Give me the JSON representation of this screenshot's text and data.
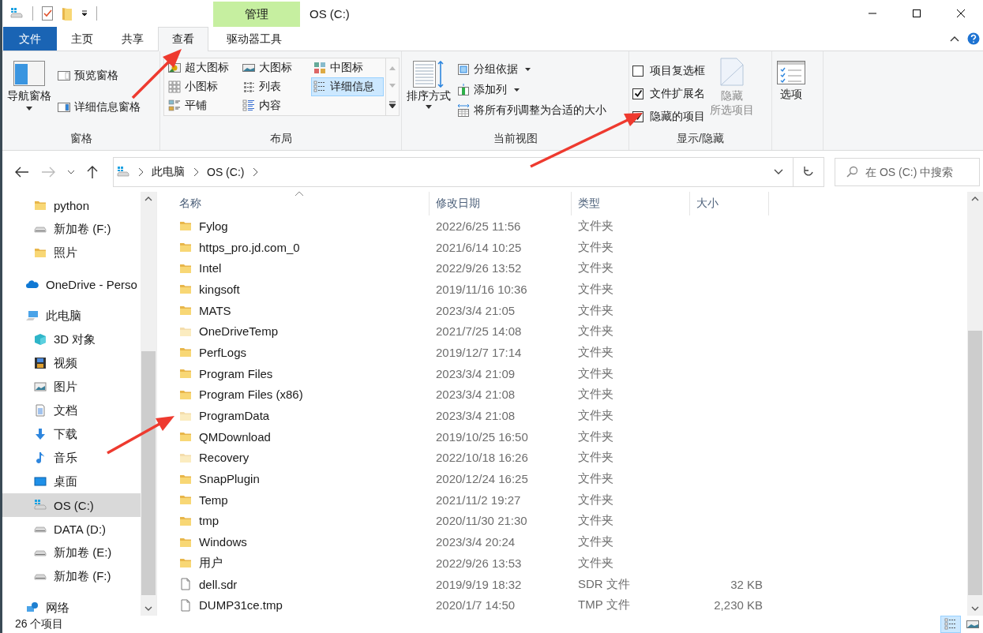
{
  "window": {
    "title": "OS (C:)",
    "context_tab_header": "管理"
  },
  "tabs": [
    {
      "label": "文件",
      "kind": "file",
      "selected": false
    },
    {
      "label": "主页",
      "kind": "normal",
      "selected": false
    },
    {
      "label": "共享",
      "kind": "normal",
      "selected": false
    },
    {
      "label": "查看",
      "kind": "normal",
      "selected": true
    },
    {
      "label": "驱动器工具",
      "kind": "context",
      "selected": false
    }
  ],
  "ribbon": {
    "panes": {
      "label": "窗格",
      "nav_button": "导航窗格",
      "items": [
        "预览窗格",
        "详细信息窗格"
      ]
    },
    "layout": {
      "label": "布局",
      "options": [
        {
          "label": "超大图标",
          "kind": "xl",
          "selected": false
        },
        {
          "label": "大图标",
          "kind": "large",
          "selected": false
        },
        {
          "label": "中图标",
          "kind": "medium",
          "selected": false
        },
        {
          "label": "小图标",
          "kind": "small",
          "selected": false
        },
        {
          "label": "列表",
          "kind": "list",
          "selected": false
        },
        {
          "label": "详细信息",
          "kind": "details",
          "selected": true
        },
        {
          "label": "平铺",
          "kind": "tiles",
          "selected": false
        },
        {
          "label": "内容",
          "kind": "content",
          "selected": false
        }
      ]
    },
    "current_view": {
      "label": "当前视图",
      "sort_button": "排序方式",
      "items": [
        {
          "label": "分组依据",
          "kind": "group",
          "dropdown": true
        },
        {
          "label": "添加列",
          "kind": "addcol",
          "dropdown": true
        },
        {
          "label": "将所有列调整为合适的大小",
          "kind": "fit",
          "dropdown": false
        }
      ]
    },
    "show_hide": {
      "label": "显示/隐藏",
      "checkboxes": [
        {
          "label": "项目复选框",
          "checked": false
        },
        {
          "label": "文件扩展名",
          "checked": true
        },
        {
          "label": "隐藏的项目",
          "checked": true
        }
      ],
      "hide_button": {
        "lines": [
          "隐藏",
          "所选项目"
        ],
        "disabled": true
      }
    },
    "options": {
      "label": "选项"
    }
  },
  "address": {
    "crumbs": [
      "此电脑",
      "OS (C:)"
    ],
    "search_placeholder": "在 OS (C:) 中搜索"
  },
  "nav": {
    "quick_access": [
      {
        "label": "python",
        "kind": "folder",
        "selected": false
      },
      {
        "label": "新加卷 (F:)",
        "kind": "drive",
        "selected": false
      },
      {
        "label": "照片",
        "kind": "folder",
        "selected": false
      }
    ],
    "items": [
      {
        "label": "OneDrive - Perso",
        "kind": "cloud",
        "selected": false
      },
      {
        "label": "此电脑",
        "kind": "computer",
        "selected": false,
        "children": [
          {
            "label": "3D 对象",
            "kind": "cube",
            "selected": false
          },
          {
            "label": "视频",
            "kind": "video",
            "selected": false
          },
          {
            "label": "图片",
            "kind": "image",
            "selected": false
          },
          {
            "label": "文档",
            "kind": "document",
            "selected": false
          },
          {
            "label": "下载",
            "kind": "download",
            "selected": false
          },
          {
            "label": "音乐",
            "kind": "music",
            "selected": false
          },
          {
            "label": "桌面",
            "kind": "desktop",
            "selected": false
          },
          {
            "label": "OS (C:)",
            "kind": "osdrive",
            "selected": true
          },
          {
            "label": "DATA (D:)",
            "kind": "drive",
            "selected": false
          },
          {
            "label": "新加卷 (E:)",
            "kind": "drive",
            "selected": false
          },
          {
            "label": "新加卷 (F:)",
            "kind": "drive",
            "selected": false
          }
        ]
      },
      {
        "label": "网络",
        "kind": "network",
        "selected": false
      }
    ]
  },
  "table": {
    "columns": [
      "名称",
      "修改日期",
      "类型",
      "大小"
    ],
    "rows": [
      {
        "name": "Fylog",
        "date": "2022/6/25 11:56",
        "type": "文件夹",
        "kind": "folder",
        "hidden": false
      },
      {
        "name": "https_pro.jd.com_0",
        "date": "2021/6/14 10:25",
        "type": "文件夹",
        "kind": "folder",
        "hidden": false
      },
      {
        "name": "Intel",
        "date": "2022/9/26 13:52",
        "type": "文件夹",
        "kind": "folder",
        "hidden": false
      },
      {
        "name": "kingsoft",
        "date": "2019/11/16 10:36",
        "type": "文件夹",
        "kind": "folder",
        "hidden": false
      },
      {
        "name": "MATS",
        "date": "2023/3/4 21:05",
        "type": "文件夹",
        "kind": "folder",
        "hidden": false
      },
      {
        "name": "OneDriveTemp",
        "date": "2021/7/25 14:08",
        "type": "文件夹",
        "kind": "folder",
        "hidden": true
      },
      {
        "name": "PerfLogs",
        "date": "2019/12/7 17:14",
        "type": "文件夹",
        "kind": "folder",
        "hidden": false
      },
      {
        "name": "Program Files",
        "date": "2023/3/4 21:09",
        "type": "文件夹",
        "kind": "folder",
        "hidden": false
      },
      {
        "name": "Program Files (x86)",
        "date": "2023/3/4 21:08",
        "type": "文件夹",
        "kind": "folder",
        "hidden": false
      },
      {
        "name": "ProgramData",
        "date": "2023/3/4 21:08",
        "type": "文件夹",
        "kind": "folder",
        "hidden": true
      },
      {
        "name": "QMDownload",
        "date": "2019/10/25 16:50",
        "type": "文件夹",
        "kind": "folder",
        "hidden": false
      },
      {
        "name": "Recovery",
        "date": "2022/10/18 16:26",
        "type": "文件夹",
        "kind": "folder",
        "hidden": true
      },
      {
        "name": "SnapPlugin",
        "date": "2020/12/24 16:25",
        "type": "文件夹",
        "kind": "folder",
        "hidden": false
      },
      {
        "name": "Temp",
        "date": "2021/11/2 19:27",
        "type": "文件夹",
        "kind": "folder",
        "hidden": false
      },
      {
        "name": "tmp",
        "date": "2020/11/30 21:30",
        "type": "文件夹",
        "kind": "folder",
        "hidden": false
      },
      {
        "name": "Windows",
        "date": "2023/3/4 20:24",
        "type": "文件夹",
        "kind": "folder",
        "hidden": false
      },
      {
        "name": "用户",
        "date": "2022/9/26 13:53",
        "type": "文件夹",
        "kind": "folder",
        "hidden": false
      },
      {
        "name": "dell.sdr",
        "date": "2019/9/19 18:32",
        "type": "SDR 文件",
        "size": "32 KB",
        "kind": "file",
        "hidden": false
      },
      {
        "name": "DUMP31ce.tmp",
        "date": "2020/1/7 14:50",
        "type": "TMP 文件",
        "size": "2,230 KB",
        "kind": "file",
        "hidden": false
      }
    ]
  },
  "status_bar": {
    "count": "26 个项目",
    "views": [
      {
        "kind": "details",
        "selected": true
      },
      {
        "kind": "large",
        "selected": false
      }
    ]
  }
}
